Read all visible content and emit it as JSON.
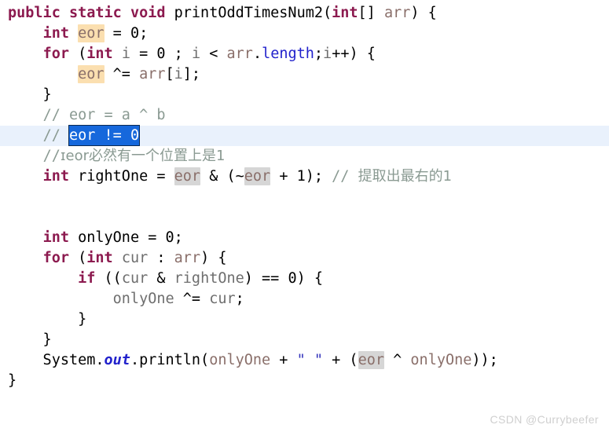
{
  "editor": {
    "language": "java",
    "theme": "light",
    "colors": {
      "background": "#ffffff",
      "keyword": "#8c1a4f",
      "identifier": "#6e6e6e",
      "parameter": "#8a6f6a",
      "field": "#2222cc",
      "string": "#3333bb",
      "comment": "#8a9a92",
      "occurrence_write": "#fbdfb0",
      "occurrence_read": "#d6d6d6",
      "selection": "#1668dc",
      "selection_text": "#ffffff",
      "current_line": "#e9f1fc",
      "watermark": "#cfcfcf"
    },
    "selection_text": "eor != 0",
    "current_line_number": 8
  },
  "lines": [
    {
      "n": 1,
      "tokens": [
        {
          "t": "public",
          "c": "kw"
        },
        {
          "t": " ",
          "c": "plain"
        },
        {
          "t": "static",
          "c": "kw"
        },
        {
          "t": " ",
          "c": "plain"
        },
        {
          "t": "void",
          "c": "kw"
        },
        {
          "t": " printOddTimesNum2(",
          "c": "plain"
        },
        {
          "t": "int",
          "c": "kw"
        },
        {
          "t": "[] ",
          "c": "plain"
        },
        {
          "t": "arr",
          "c": "param"
        },
        {
          "t": ") {",
          "c": "plain"
        }
      ]
    },
    {
      "n": 2,
      "tokens": [
        {
          "t": "    ",
          "c": "plain"
        },
        {
          "t": "int",
          "c": "kw"
        },
        {
          "t": " ",
          "c": "plain"
        },
        {
          "t": "eor",
          "c": "hl-orange"
        },
        {
          "t": " = ",
          "c": "plain"
        },
        {
          "t": "0",
          "c": "num"
        },
        {
          "t": ";",
          "c": "plain"
        }
      ]
    },
    {
      "n": 3,
      "tokens": [
        {
          "t": "    ",
          "c": "plain"
        },
        {
          "t": "for",
          "c": "kw"
        },
        {
          "t": " (",
          "c": "plain"
        },
        {
          "t": "int",
          "c": "kw"
        },
        {
          "t": " ",
          "c": "plain"
        },
        {
          "t": "i",
          "c": "ident"
        },
        {
          "t": " = ",
          "c": "plain"
        },
        {
          "t": "0",
          "c": "num"
        },
        {
          "t": " ; ",
          "c": "plain"
        },
        {
          "t": "i",
          "c": "ident"
        },
        {
          "t": " < ",
          "c": "plain"
        },
        {
          "t": "arr",
          "c": "param"
        },
        {
          "t": ".",
          "c": "plain"
        },
        {
          "t": "length",
          "c": "field"
        },
        {
          "t": ";",
          "c": "plain"
        },
        {
          "t": "i",
          "c": "ident"
        },
        {
          "t": "++) {",
          "c": "plain"
        }
      ]
    },
    {
      "n": 4,
      "tokens": [
        {
          "t": "        ",
          "c": "plain"
        },
        {
          "t": "eor",
          "c": "hl-orange"
        },
        {
          "t": " ^= ",
          "c": "plain"
        },
        {
          "t": "arr",
          "c": "param"
        },
        {
          "t": "[",
          "c": "plain"
        },
        {
          "t": "i",
          "c": "ident"
        },
        {
          "t": "];",
          "c": "plain"
        }
      ]
    },
    {
      "n": 5,
      "tokens": [
        {
          "t": "    }",
          "c": "plain"
        }
      ]
    },
    {
      "n": 6,
      "tokens": [
        {
          "t": "    ",
          "c": "plain"
        },
        {
          "t": "// eor = a ^ b",
          "c": "comment"
        }
      ]
    },
    {
      "n": 7,
      "tokens": [
        {
          "t": "    ",
          "c": "plain"
        },
        {
          "t": "// ",
          "c": "comment"
        },
        {
          "t": "eor != 0",
          "c": "sel"
        }
      ]
    },
    {
      "n": 8,
      "tokens": [
        {
          "t": "    ",
          "c": "plain"
        },
        {
          "t": "//",
          "c": "comment"
        },
        {
          "t": "ɪeor必然有一个位置上是1",
          "c": "cn"
        }
      ]
    },
    {
      "n": 9,
      "tokens": [
        {
          "t": "    ",
          "c": "plain"
        },
        {
          "t": "int",
          "c": "kw"
        },
        {
          "t": " rightOne = ",
          "c": "plain"
        },
        {
          "t": "eor",
          "c": "hl-gray"
        },
        {
          "t": " & (~",
          "c": "plain"
        },
        {
          "t": "eor",
          "c": "hl-gray"
        },
        {
          "t": " + ",
          "c": "plain"
        },
        {
          "t": "1",
          "c": "num"
        },
        {
          "t": "); ",
          "c": "plain"
        },
        {
          "t": "// ",
          "c": "comment"
        },
        {
          "t": "提取出最右的1",
          "c": "cn"
        }
      ]
    },
    {
      "n": 10,
      "tokens": []
    },
    {
      "n": 11,
      "tokens": []
    },
    {
      "n": 12,
      "tokens": [
        {
          "t": "    ",
          "c": "plain"
        },
        {
          "t": "int",
          "c": "kw"
        },
        {
          "t": " onlyOne = ",
          "c": "plain"
        },
        {
          "t": "0",
          "c": "num"
        },
        {
          "t": ";",
          "c": "plain"
        }
      ]
    },
    {
      "n": 13,
      "tokens": [
        {
          "t": "    ",
          "c": "plain"
        },
        {
          "t": "for",
          "c": "kw"
        },
        {
          "t": " (",
          "c": "plain"
        },
        {
          "t": "int",
          "c": "kw"
        },
        {
          "t": " ",
          "c": "plain"
        },
        {
          "t": "cur",
          "c": "ident"
        },
        {
          "t": " : ",
          "c": "plain"
        },
        {
          "t": "arr",
          "c": "param"
        },
        {
          "t": ") {",
          "c": "plain"
        }
      ]
    },
    {
      "n": 14,
      "tokens": [
        {
          "t": "        ",
          "c": "plain"
        },
        {
          "t": "if",
          "c": "kw"
        },
        {
          "t": " ((",
          "c": "plain"
        },
        {
          "t": "cur",
          "c": "ident"
        },
        {
          "t": " & ",
          "c": "plain"
        },
        {
          "t": "rightOne",
          "c": "ident"
        },
        {
          "t": ") == ",
          "c": "plain"
        },
        {
          "t": "0",
          "c": "num"
        },
        {
          "t": ") {",
          "c": "plain"
        }
      ]
    },
    {
      "n": 15,
      "tokens": [
        {
          "t": "            ",
          "c": "plain"
        },
        {
          "t": "onlyOne",
          "c": "ident"
        },
        {
          "t": " ^= ",
          "c": "plain"
        },
        {
          "t": "cur",
          "c": "ident"
        },
        {
          "t": ";",
          "c": "plain"
        }
      ]
    },
    {
      "n": 16,
      "tokens": [
        {
          "t": "        }",
          "c": "plain"
        }
      ]
    },
    {
      "n": 17,
      "tokens": [
        {
          "t": "    }",
          "c": "plain"
        }
      ]
    },
    {
      "n": 18,
      "tokens": [
        {
          "t": "    System.",
          "c": "plain"
        },
        {
          "t": "out",
          "c": "statfld"
        },
        {
          "t": ".println(",
          "c": "plain"
        },
        {
          "t": "onlyOne",
          "c": "param"
        },
        {
          "t": " + ",
          "c": "plain"
        },
        {
          "t": "\" \"",
          "c": "str"
        },
        {
          "t": " + (",
          "c": "plain"
        },
        {
          "t": "eor",
          "c": "hl-gray"
        },
        {
          "t": " ^ ",
          "c": "plain"
        },
        {
          "t": "onlyOne",
          "c": "param"
        },
        {
          "t": "));",
          "c": "plain"
        }
      ]
    },
    {
      "n": 19,
      "tokens": [
        {
          "t": "}",
          "c": "plain"
        }
      ]
    }
  ],
  "watermark": {
    "text": "CSDN @Currybeefer"
  }
}
